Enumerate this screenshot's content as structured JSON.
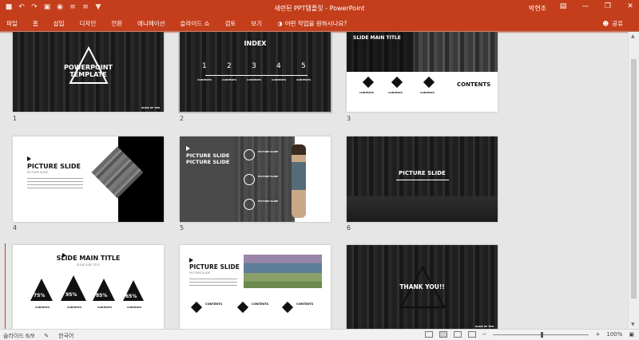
{
  "app": {
    "window_title": "새련된 PPT템플릿 - PowerPoint",
    "user": "박현조",
    "brand_color": "#c43e1c"
  },
  "qat": {
    "icons": [
      "save-icon",
      "undo-icon",
      "redo-icon",
      "start-icon",
      "touch-mode-icon"
    ]
  },
  "ribbon": {
    "tabs": [
      "파일",
      "홈",
      "삽입",
      "디자인",
      "전환",
      "애니메이션",
      "슬라이드 쇼",
      "검토",
      "보기"
    ],
    "tell_me": "어떤 작업을 원하시나요?",
    "share": "공유"
  },
  "slides": [
    {
      "number": "1",
      "title_line1": "POWERPOINT",
      "title_line2": "TEMPLATE",
      "footer": "SLIDE OF TEN"
    },
    {
      "number": "2",
      "title": "INDEX",
      "items": [
        "1",
        "2",
        "3",
        "4",
        "5"
      ],
      "item_label": "CONTENTS"
    },
    {
      "number": "3",
      "title": "SLIDE MAIN TITLE",
      "contents": "CONTENTS",
      "item_label": "CONTENTS"
    },
    {
      "number": "4",
      "title": "PICTURE SLIDE",
      "subtitle": "PICTURE SLIDE"
    },
    {
      "number": "5",
      "title_line1": "PICTURE SLIDE",
      "title_line2": "PICTURE SLIDE",
      "item_label": "PICTURE SLIDE",
      "item_label2": "CONTENTS"
    },
    {
      "number": "6",
      "title": "PICTURE SLIDE"
    },
    {
      "number": "7",
      "title": "SLIDE MAIN TITLE",
      "subtitle": "SLIDE SUB TITLE",
      "percentages": [
        "75%",
        "95%",
        "85%",
        "65%"
      ],
      "item_label": "CONTENTS"
    },
    {
      "number": "8",
      "title": "PICTURE SLIDE",
      "subtitle": "PICTURE SLIDE",
      "item_label": "CONTENTS"
    },
    {
      "number": "9",
      "title": "THANK YOU!!",
      "footer": "SLIDE OF TEN"
    }
  ],
  "statusbar": {
    "slide_indicator": "슬라이드 6/9",
    "language": "한국어",
    "zoom": "100%"
  }
}
